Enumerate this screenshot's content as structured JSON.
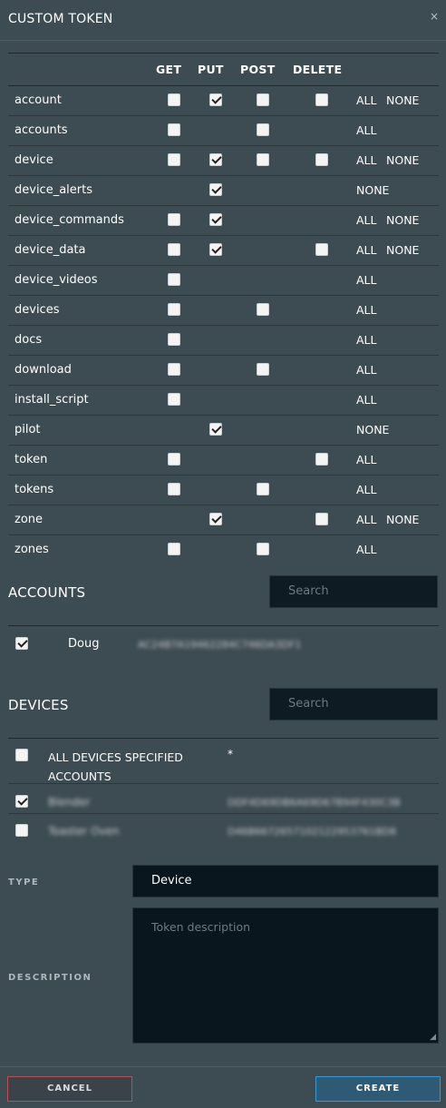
{
  "header": {
    "title": "CUSTOM TOKEN",
    "close_glyph": "×"
  },
  "permissions": {
    "columns": [
      "GET",
      "PUT",
      "POST",
      "DELETE"
    ],
    "rows": [
      {
        "name": "account",
        "get": false,
        "put": true,
        "post": false,
        "delete": false,
        "links": [
          "ALL",
          "NONE"
        ]
      },
      {
        "name": "accounts",
        "get": false,
        "put": null,
        "post": false,
        "delete": null,
        "links": [
          "ALL"
        ]
      },
      {
        "name": "device",
        "get": false,
        "put": true,
        "post": false,
        "delete": false,
        "links": [
          "ALL",
          "NONE"
        ]
      },
      {
        "name": "device_alerts",
        "get": null,
        "put": true,
        "post": null,
        "delete": null,
        "links": [
          "NONE"
        ]
      },
      {
        "name": "device_commands",
        "get": false,
        "put": true,
        "post": null,
        "delete": null,
        "links": [
          "ALL",
          "NONE"
        ]
      },
      {
        "name": "device_data",
        "get": false,
        "put": true,
        "post": null,
        "delete": false,
        "links": [
          "ALL",
          "NONE"
        ]
      },
      {
        "name": "device_videos",
        "get": false,
        "put": null,
        "post": null,
        "delete": null,
        "links": [
          "ALL"
        ]
      },
      {
        "name": "devices",
        "get": false,
        "put": null,
        "post": false,
        "delete": null,
        "links": [
          "ALL"
        ]
      },
      {
        "name": "docs",
        "get": false,
        "put": null,
        "post": null,
        "delete": null,
        "links": [
          "ALL"
        ]
      },
      {
        "name": "download",
        "get": false,
        "put": null,
        "post": false,
        "delete": null,
        "links": [
          "ALL"
        ]
      },
      {
        "name": "install_script",
        "get": false,
        "put": null,
        "post": null,
        "delete": null,
        "links": [
          "ALL"
        ]
      },
      {
        "name": "pilot",
        "get": null,
        "put": true,
        "post": null,
        "delete": null,
        "links": [
          "NONE"
        ]
      },
      {
        "name": "token",
        "get": false,
        "put": null,
        "post": null,
        "delete": false,
        "links": [
          "ALL"
        ]
      },
      {
        "name": "tokens",
        "get": false,
        "put": null,
        "post": false,
        "delete": null,
        "links": [
          "ALL"
        ]
      },
      {
        "name": "zone",
        "get": null,
        "put": true,
        "post": null,
        "delete": false,
        "links": [
          "ALL",
          "NONE"
        ]
      },
      {
        "name": "zones",
        "get": false,
        "put": null,
        "post": false,
        "delete": null,
        "links": [
          "ALL"
        ]
      }
    ]
  },
  "accounts": {
    "heading": "ACCOUNTS",
    "search_placeholder": "Search",
    "items": [
      {
        "name": "Doug",
        "id": "AC24B7A19462284C746DA3DF1",
        "checked": true
      }
    ]
  },
  "devices": {
    "heading": "DEVICES",
    "search_placeholder": "Search",
    "all_label": "ALL DEVICES SPECIFIED ACCOUNTS",
    "all_value": "*",
    "all_checked": false,
    "items": [
      {
        "name": "Blender",
        "id": "DDF4D69DB6A69D67B94F430C3B",
        "checked": true
      },
      {
        "name": "Toaster Oven",
        "id": "D46B6672657102122953761BD8",
        "checked": false
      }
    ]
  },
  "type": {
    "label": "TYPE",
    "value": "Device"
  },
  "description": {
    "label": "DESCRIPTION",
    "placeholder": "Token description"
  },
  "footer": {
    "cancel_label": "CANCEL",
    "create_label": "CREATE"
  },
  "colors": {
    "cancel_border": "#b2525a",
    "create_border": "#3a9ad9",
    "create_bg": "#2f5a76"
  }
}
